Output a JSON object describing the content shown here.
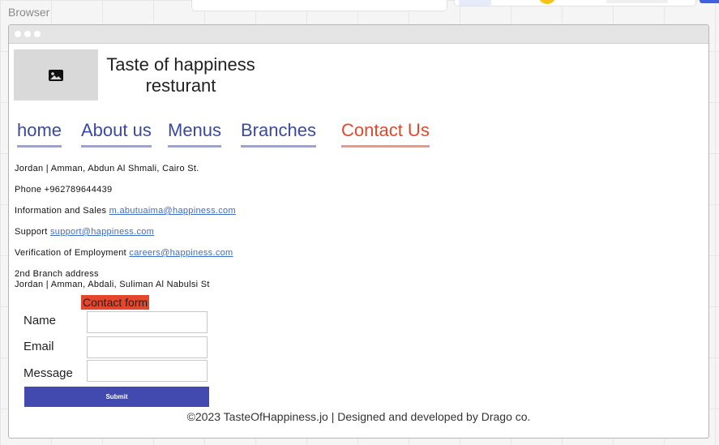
{
  "canvas": {
    "label": "Browser"
  },
  "header": {
    "logo_icon": "image-icon",
    "title_line1": "Taste of happiness",
    "title_line2": "resturant"
  },
  "nav": {
    "items": [
      {
        "label": "home",
        "active": false
      },
      {
        "label": "About us",
        "active": false
      },
      {
        "label": "Menus",
        "active": false
      },
      {
        "label": "Branches",
        "active": false
      },
      {
        "label": "Contact Us",
        "active": true
      }
    ]
  },
  "contact": {
    "address": "Jordan | Amman, Abdun Al Shmali, Cairo St.",
    "phone": "Phone +962789644439",
    "sales_label": "Information and Sales",
    "sales_email": "m.abutuaima@happiness.com",
    "support_label": "Support",
    "support_email": "support@happiness.com",
    "employment_label": "Verification of Employment",
    "employment_email": "careers@happiness.com",
    "branch2_label": "2nd Branch address",
    "branch2_address": "Jordan | Amman, Abdali, Suliman Al Nabulsi St"
  },
  "form": {
    "heading": "Contact form",
    "name_label": "Name",
    "name_value": "",
    "email_label": "Email",
    "email_value": "",
    "message_label": "Message",
    "message_value": "",
    "submit_label": "Submit"
  },
  "footer": {
    "text": "©2023 TasteOfHappiness.jo | Designed and developed by Drago co."
  },
  "colors": {
    "nav_link": "#3a4aa0",
    "nav_active": "#e0492c",
    "form_heading_bg": "#e4472b",
    "submit_bg": "#4249af",
    "email_link": "#3c6dc7"
  }
}
